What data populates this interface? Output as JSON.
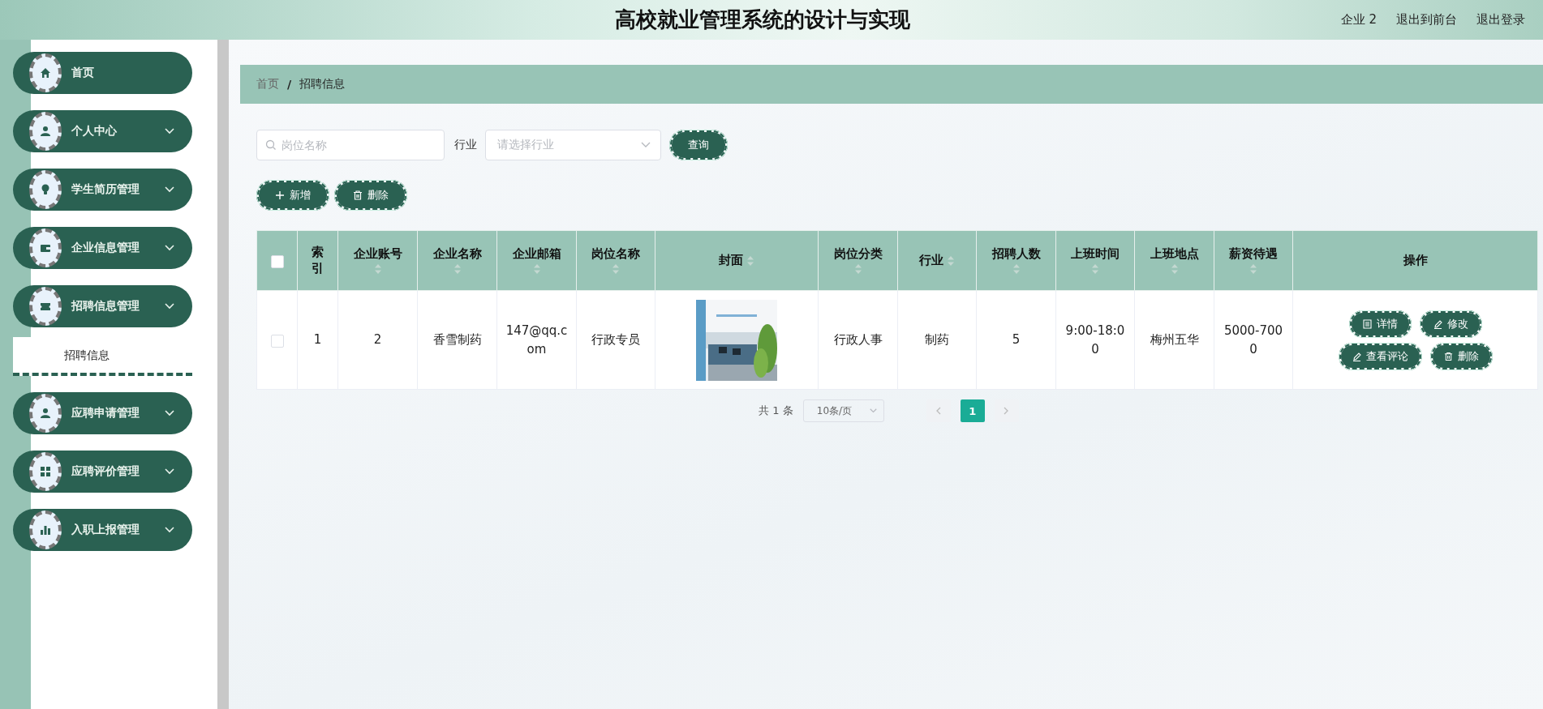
{
  "header": {
    "title": "高校就业管理系统的设计与实现",
    "links": [
      "企业 2",
      "退出到前台",
      "退出登录"
    ]
  },
  "sidebar": {
    "items": [
      {
        "label": "首页",
        "kind": "link"
      },
      {
        "label": "个人中心",
        "kind": "submenu"
      },
      {
        "label": "学生简历管理",
        "kind": "submenu"
      },
      {
        "label": "企业信息管理",
        "kind": "submenu"
      },
      {
        "label": "招聘信息管理",
        "kind": "submenu",
        "children": [
          {
            "label": "招聘信息"
          }
        ]
      },
      {
        "label": "应聘申请管理",
        "kind": "submenu"
      },
      {
        "label": "应聘评价管理",
        "kind": "submenu"
      },
      {
        "label": "入职上报管理",
        "kind": "submenu"
      }
    ]
  },
  "breadcrumb": [
    "首页",
    "/",
    "招聘信息"
  ],
  "search": {
    "placeholder": "岗位名称",
    "industry_label": "行业",
    "industry_placeholder": "请选择行业",
    "button": "查询"
  },
  "toolbar": [
    {
      "label": "新增",
      "kind": "add"
    },
    {
      "label": "删除",
      "kind": "delete"
    }
  ],
  "table": {
    "select_all": {
      "checked": false
    },
    "columns": [
      {
        "label": "索引",
        "sortable": false
      },
      {
        "label": "企业账号",
        "sortable": true
      },
      {
        "label": "企业名称",
        "sortable": true
      },
      {
        "label": "企业邮箱",
        "sortable": true
      },
      {
        "label": "岗位名称",
        "sortable": true
      },
      {
        "label": "封面",
        "sortable": true
      },
      {
        "label": "岗位分类",
        "sortable": true
      },
      {
        "label": "行业",
        "sortable": true
      },
      {
        "label": "招聘人数",
        "sortable": true
      },
      {
        "label": "上班时间",
        "sortable": true
      },
      {
        "label": "上班地点",
        "sortable": true
      },
      {
        "label": "薪资待遇",
        "sortable": true
      },
      {
        "label": "操作",
        "sortable": false
      }
    ],
    "rows": [
      {
        "selected": false,
        "cells": [
          "1",
          "2",
          "香雪制药",
          "147@qq.com",
          "行政专员",
          {
            "kind": "picture"
          },
          "行政人事",
          "制药",
          "5",
          "9:00-18:00",
          "梅州五华",
          "5000-7000"
        ],
        "actions": [
          {
            "label": "详情",
            "kind": "view"
          },
          {
            "label": "修改",
            "kind": "edit"
          },
          {
            "label": "查看评论",
            "kind": "edit"
          },
          {
            "label": "删除",
            "kind": "delete"
          }
        ]
      }
    ]
  },
  "pagination": {
    "total": "共 1 条",
    "page_size": "10条/页",
    "pages": [
      {
        "label": "1",
        "selected": true
      }
    ]
  }
}
